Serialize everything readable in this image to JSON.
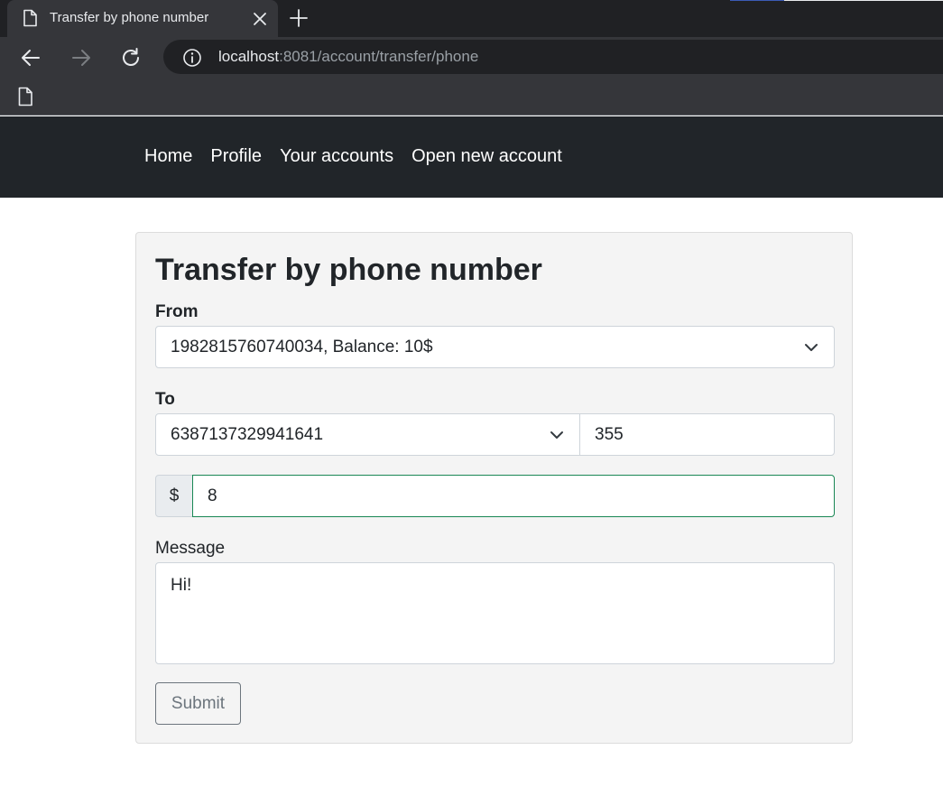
{
  "browser": {
    "tab_title": "Transfer by phone number",
    "url_host": "localhost",
    "url_rest": ":8081/account/transfer/phone"
  },
  "navbar": {
    "links": [
      "Home",
      "Profile",
      "Your accounts",
      "Open new account"
    ]
  },
  "form": {
    "title": "Transfer by phone number",
    "from_label": "From",
    "from_selected": "1982815760740034, Balance: 10$",
    "to_label": "To",
    "to_selected": "6387137329941641",
    "to_phone": "355",
    "currency_symbol": "$",
    "amount": "8",
    "message_label": "Message",
    "message": "Hi!",
    "submit_label": "Submit"
  },
  "colors": {
    "navbar_bg": "#212529",
    "card_bg": "#f4f4f4",
    "valid_border": "#198754",
    "button_outline": "#6c757d"
  }
}
